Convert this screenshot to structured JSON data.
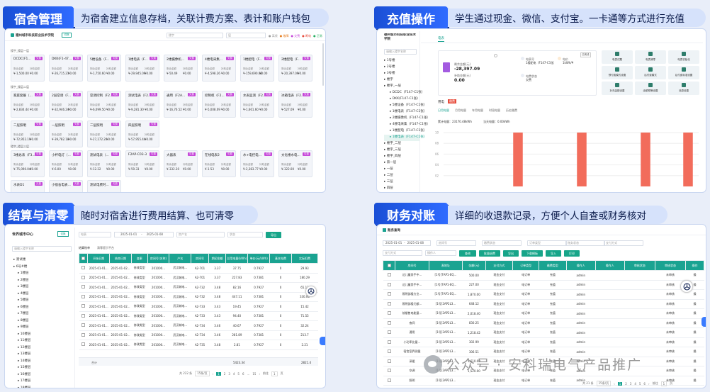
{
  "sections": {
    "dorm": {
      "title": "宿舍管理",
      "desc": "为宿舍建立信息存档，关联计费方案、表计和账户钱包"
    },
    "recharge": {
      "title": "充值操作",
      "desc": "学生通过现金、微信、支付宝。一卡通等方式进行充值"
    },
    "settle": {
      "title": "结算与清零",
      "desc": "随时对宿舍进行费用结算、也可清零"
    },
    "finance": {
      "title": "财务对账",
      "desc": "详细的收退款记录，方便个人自查或财务核对"
    }
  },
  "dorm_screen": {
    "school": "德州城市科技职业技术学院",
    "tag": "切换",
    "filter1": "楼宇",
    "filter2": "层",
    "legend": [
      "● 离线",
      "● 故障",
      "● 欠费",
      "● 断电",
      "● 正常"
    ],
    "floor_labels": [
      "楼宇_楼层一层",
      "楼宇_楼层二层",
      "楼宇_楼层三层"
    ],
    "rooms_floor1": [
      {
        "name": "DCDC(F1...",
        "tag": "欠费",
        "v1": "¥-1,500.00",
        "v2": "¥0.00"
      },
      {
        "name": "DKK(F1-47...",
        "tag": "欠费",
        "v1": "¥-26,715.21",
        "v2": "¥0.00"
      },
      {
        "name": "5楼设备（F...",
        "tag": "欠费",
        "v1": "¥-1,750.60",
        "v2": "¥0.00"
      },
      {
        "name": "1楼电表（F...",
        "tag": "欠费",
        "v1": "¥-29,945.09",
        "v2": "¥0.00"
      },
      {
        "name": "2楼摄像机...",
        "tag": "欠费",
        "v1": "¥-50.49",
        "v2": "¥0.00"
      },
      {
        "name": "4楼电采集...",
        "tag": "欠费",
        "v1": "¥-4,598.26",
        "v2": "¥0.00"
      },
      {
        "name": "1楼配电（F...",
        "tag": "欠费",
        "v1": "¥-159,690.00",
        "v2": "¥0.00"
      },
      {
        "name": "2楼配电（F...",
        "tag": "欠费",
        "v1": "¥-20,397.09",
        "v2": "¥0.00"
      }
    ],
    "rooms_floor2": [
      {
        "name": "家庭套餐（...",
        "tag": "欠费",
        "v1": "¥-2,834.44",
        "v2": "¥0.00"
      },
      {
        "name": "2层空调（F...",
        "tag": "欠费",
        "v1": "¥-32,946.24",
        "v2": "¥0.00"
      },
      {
        "name": "空调控制（F2...",
        "tag": "欠费",
        "v1": "¥-6,099.50",
        "v2": "¥0.00"
      },
      {
        "name": "测试电表（F2...",
        "tag": "欠费",
        "v1": "¥-9,281.30",
        "v2": "¥0.00"
      },
      {
        "name": "通用（F2A...",
        "tag": "欠费",
        "v1": "¥-16,76.52",
        "v2": "¥0.00"
      },
      {
        "name": "控制柜（F2...",
        "tag": "欠费",
        "v1": "¥-5,008.09",
        "v2": "¥0.00"
      },
      {
        "name": "水表监测（F2...",
        "tag": "欠费",
        "v1": "¥-1,661.60",
        "v2": "¥0.00"
      },
      {
        "name": "冰箱电表（F2...",
        "tag": "欠费",
        "v1": "¥-527.09",
        "v2": "¥0.00"
      },
      {
        "name": "二层照明",
        "tag": "欠费",
        "v1": "¥-72,952.19",
        "v2": "¥0.00"
      },
      {
        "name": "一层照明",
        "tag": "欠费",
        "v1": "¥-39,782.18",
        "v2": "¥0.00"
      },
      {
        "name": "二层照明",
        "tag": "欠费",
        "v1": "¥-27,272.20",
        "v2": "¥0.00"
      },
      {
        "name": "四层照明",
        "tag": "欠费",
        "v1": "¥-57,955.44",
        "v2": "¥0.00"
      }
    ],
    "rooms_floor3": [
      {
        "name": "3楼总表（F3...",
        "tag": "欠费",
        "v1": "¥-75,090.04",
        "v2": "¥0.00"
      },
      {
        "name": "小杯电灯（...",
        "tag": "欠费",
        "v1": "¥-6.00",
        "v2": "¥0.00"
      },
      {
        "name": "测试电表（...",
        "tag": "欠费",
        "v1": "¥-12.22",
        "v2": "¥0.00"
      },
      {
        "name": "F2AP-C03-3",
        "tag": "欠费",
        "v1": "¥-59.33",
        "v2": "¥0.00"
      },
      {
        "name": "大器表",
        "tag": "欠费",
        "v1": "¥-332.30",
        "v2": "¥0.00"
      },
      {
        "name": "在线电表2",
        "tag": "欠费",
        "v1": "¥-1.53",
        "v2": "¥0.00"
      },
      {
        "name": "水+电控电...",
        "tag": "欠费",
        "v1": "¥-2,383.77",
        "v2": "¥0.00"
      },
      {
        "name": "文化楼水电...",
        "tag": "欠费",
        "v1": "¥-322.00",
        "v2": "¥0.00"
      },
      {
        "name": "水表D1",
        "tag": "欠费",
        "v1": "",
        "v2": ""
      },
      {
        "name": "小宿舍电表...",
        "tag": "欠费",
        "v1": "",
        "v2": ""
      },
      {
        "name": "测试电费时...",
        "tag": "欠费",
        "v1": "",
        "v2": ""
      }
    ],
    "lbl_bal": "剩余金额",
    "lbl_sub": "补助金额"
  },
  "recharge_screen": {
    "org": "德州城市科技职业技术学院",
    "search_ph": "请输入楼宇名称",
    "tab": "电表",
    "tree": [
      "1号楼",
      "2号楼",
      "3号楼",
      "楼宇",
      "楼宇_一层",
      "DCDC（F147-C1张）",
      "DKK(F147-C1张)",
      "5楼设备（F147-C1张）",
      "1楼电表（F147-C1张）",
      "2楼摄像机（F147-C1张）",
      "4楼电采集（F147-C1张）",
      "1楼配电（F147-C1张）",
      "1楼电表（F147-C1张）",
      "楼宇_二层",
      "楼宇_三层",
      "楼宇_四层",
      "第一层",
      "一层",
      "二层",
      "三层",
      "四层"
    ],
    "balance_label": "剩余金额(元)",
    "balance_value": "-28,397.09",
    "subsidy_label": "补助金额(元)",
    "subsidy_value": "0.00",
    "info1_label": "电表号",
    "info1_value": "1楼配电（F147-C1张）",
    "info2_label": "电价",
    "info2_value": "1kWh/¥",
    "info3_label": "电费状态",
    "info3_value": "欠费",
    "status_badge": "已离线",
    "ops": [
      "电表试题",
      "电表清零",
      "电表初始化",
      "预付费模式设置",
      "后付费模式",
      "后付费标准设置",
      "补充金额设置",
      "余额预警设置",
      "还原设置"
    ],
    "tabs2": [
      "用电",
      "缴费"
    ],
    "subtabs": [
      "日用电量",
      "月用电量",
      "年用电量",
      "时段电量",
      "历史缴费"
    ],
    "usage_label": "累计电量：23170.48kWh",
    "today_label": "当天电量：0.00kWh",
    "chart_y": [
      "10",
      "08",
      "06",
      "04",
      "02"
    ]
  },
  "chart_data": {
    "type": "bar",
    "title": "",
    "xlabel": "",
    "ylabel": "",
    "ylim": [
      0,
      10
    ],
    "categories": [
      "1",
      "2",
      "3",
      "4",
      "5",
      "6",
      "7",
      "8",
      "9",
      "10",
      "11",
      "12"
    ],
    "values": [
      0,
      0,
      0,
      10,
      0,
      0,
      10,
      0,
      0,
      10,
      0,
      10
    ],
    "color": "#f26c5b"
  },
  "settle_screen": {
    "org": "世界城市中心",
    "tag": "切换",
    "search_ph": "请输入楼宇名称",
    "tree": [
      "测试楼",
      "6号#楼",
      "1楼层",
      "2楼层",
      "3楼层",
      "4楼层",
      "5楼层",
      "6楼层",
      "7楼层",
      "8楼层",
      "9楼层",
      "10楼层",
      "11楼层",
      "12楼层",
      "13楼层",
      "14楼层",
      "15楼层",
      "16楼层",
      "17楼层",
      "18楼层"
    ],
    "filters": [
      "电表",
      "2025-01-01",
      "2025-01-08",
      "房产名",
      "状态"
    ],
    "export": "导出",
    "tabs": [
      "结算账单",
      "清零提示平台"
    ],
    "headers": [
      "开始日期",
      "结束日期",
      "变更",
      "房间号(名称)",
      "户名",
      "房间号",
      "期初金额",
      "总用电量(kWh)",
      "单价(元/kWh)",
      "基本电费",
      "实际扣费"
    ],
    "rows": [
      [
        "2025-01-01...",
        "2025-01-02...",
        "修改类型",
        "201000...",
        "武汉城电...",
        "A2-701",
        "3.37",
        "37.75",
        "0.7927",
        "0",
        "29.93"
      ],
      [
        "2025-01-01...",
        "2025-01-02...",
        "修改类型",
        "201000...",
        "武汉城电...",
        "A2-701",
        "3.37",
        "227.83",
        "0.7381",
        "0",
        "180.29"
      ],
      [
        "2025-01-01...",
        "2025-01-02...",
        "修改类型",
        "201000...",
        "武汉城电...",
        "A2-732",
        "3.48",
        "82.16",
        "0.7927",
        "0",
        "65.13"
      ],
      [
        "2025-01-01...",
        "2025-01-02...",
        "修改类型",
        "201000...",
        "武汉城电...",
        "A2-732",
        "3.48",
        "447.11",
        "0.7381",
        "0",
        "330.06"
      ],
      [
        "2025-01-01...",
        "2025-01-02...",
        "修改类型",
        "201000...",
        "武汉城电...",
        "A2-733",
        "3.43",
        "19.45",
        "0.7927",
        "0",
        "15.42"
      ],
      [
        "2025-01-01...",
        "2025-01-02...",
        "修改类型",
        "201000...",
        "武汉城电...",
        "A2-733",
        "3.43",
        "94.40",
        "0.7381",
        "0",
        "71.55"
      ],
      [
        "2025-01-01...",
        "2025-01-02...",
        "修改类型",
        "201000...",
        "武汉城电...",
        "A2-734",
        "3.46",
        "40.67",
        "0.7927",
        "0",
        "32.24"
      ],
      [
        "2025-01-01...",
        "2025-01-02...",
        "修改类型",
        "201000...",
        "武汉城电...",
        "A2-734",
        "3.46",
        "281.89",
        "0.7381",
        "0",
        "213.7"
      ],
      [
        "2025-01-01...",
        "2025-01-02...",
        "修改类型",
        "201000...",
        "武汉城电...",
        "A2-735",
        "3.48",
        "2.81",
        "0.7927",
        "0",
        "2.21"
      ]
    ],
    "total_label": "合计",
    "total_kwh": "5423.34",
    "total_fee": "2821.4",
    "pager_total": "共 222 条",
    "pager_size": "15条/页",
    "pages": [
      "1",
      "2",
      "3",
      "4",
      "5",
      "6",
      "...",
      "15"
    ],
    "goto_label": "前往",
    "goto_page": "1",
    "goto_unit": "页"
  },
  "finance_screen": {
    "title": "账务查询",
    "filters_row1": [
      "2025-01-01",
      "2025-01-08",
      "房间号",
      "缴费状态",
      "订单类型",
      "账务状态",
      "支付方式"
    ],
    "filters_row2": [
      "支付方式",
      "操作人"
    ],
    "buttons": [
      "查询",
      "批量退费",
      "导出",
      "下载模板",
      "导入",
      "打印"
    ],
    "headers": [
      "房间号",
      "表地址",
      "金额(元)",
      "支付方式",
      "订单类型",
      "缴费类型",
      "操作人",
      "操作人",
      "审核状态",
      "审核状态",
      "操作"
    ],
    "rows": [
      [
        "达儿童禁手中...",
        "[1号]7AP1-EQ...",
        "500.00",
        "现金支付",
        "电订单",
        "充值",
        "admin",
        "",
        "",
        "未审核",
        "操"
      ],
      [
        "达儿童禁手中...",
        "[1号]7AP1-EQ...",
        "227.00",
        "现金支付",
        "电订单",
        "充值",
        "admin",
        "",
        "",
        "未审核",
        "操"
      ],
      [
        "照明部楼方业...",
        "[1号]7AP1-EQ...",
        "1,870.00",
        "现金支付",
        "电订单",
        "充值",
        "admin",
        "",
        "",
        "未审核",
        "操"
      ],
      [
        "照明部楼元额...",
        "[1号]2AP2L3...",
        "648.12",
        "现金支付",
        "电订单",
        "充值",
        "admin",
        "",
        "",
        "未审核",
        "操"
      ],
      [
        "前楼售电能量...",
        "[1号]2AP2L3...",
        "2,018.40",
        "现金支付",
        "电订单",
        "充值",
        "admin",
        "",
        "",
        "未审核",
        "操"
      ],
      [
        "夜间",
        "[1号]2AP2L3...",
        "830.25",
        "现金支付",
        "电订单",
        "充值",
        "admin",
        "",
        "",
        "未审核",
        "操"
      ],
      [
        "通用",
        "[1号]2AP2L3...",
        "1,218.42",
        "现金支付",
        "电订单",
        "充值",
        "admin",
        "",
        "",
        "未审核",
        "操"
      ],
      [
        "小功率比量...",
        "[1号]2AP2L3...",
        "302.99",
        "现金支付",
        "电订单",
        "充值",
        "admin",
        "",
        "",
        "未审核",
        "操"
      ],
      [
        "宿舍室界测量",
        "[1号]2AP2L3...",
        "306.51",
        "现金支付",
        "电订单",
        "充值",
        "admin",
        "",
        "",
        "未审核",
        "操"
      ],
      [
        "采暖",
        "[1号]2AP2L3...",
        "1,610.00",
        "现金支付",
        "电订单",
        "充值",
        "admin",
        "",
        "",
        "未审核",
        "操"
      ],
      [
        "空调",
        "[1号]2AP2L3...",
        "1,520.00",
        "现金支付",
        "电订单",
        "充值",
        "admin",
        "",
        "",
        "未审核",
        "操"
      ],
      [
        "照明",
        "[1号]2AP2L3...",
        "",
        "现金支付",
        "电订单",
        "充值",
        "admin",
        "",
        "",
        "未审核",
        "操"
      ]
    ],
    "pager_total": "共 21 条",
    "pager_size": "15条/页",
    "pages": [
      "1",
      "2",
      "3",
      "4",
      "5",
      "6"
    ],
    "goto_label": "前往",
    "goto_page": "1",
    "goto_unit": "页"
  },
  "watermark": "公众号 · 安科瑞电气产品推广"
}
